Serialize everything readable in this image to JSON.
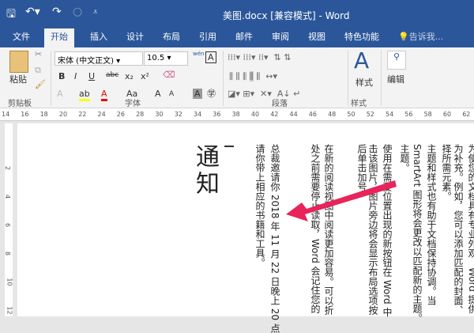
{
  "titlebar": {
    "title": "美图.docx [兼容模式] - Word"
  },
  "tabs": [
    "文件",
    "开始",
    "插入",
    "设计",
    "布局",
    "引用",
    "邮件",
    "审阅",
    "视图",
    "特色功能"
  ],
  "tell_me": "告诉我...",
  "ribbon": {
    "paste": "粘贴",
    "font_name": "宋体 (中文正文)",
    "font_size": "10.5",
    "bold": "B",
    "italic": "I",
    "underline": "U",
    "strike": "abc",
    "sub": "x₂",
    "sup": "x²",
    "change_case": "Aa",
    "grow": "A",
    "shrink": "A",
    "char_shade": "A",
    "phonetic": "wén",
    "styles": "样式",
    "editing": "编辑",
    "groups": [
      "剪贴板",
      "字体",
      "段落",
      "样式"
    ]
  },
  "ruler": [
    "14",
    "16",
    "18",
    "20",
    "22",
    "24",
    "26",
    "28",
    "30",
    "32",
    "34",
    "36",
    "38",
    "40",
    "42",
    "44",
    "46",
    "48",
    "50",
    "52",
    "54",
    "56",
    "58",
    "60",
    "62"
  ],
  "vruler": [
    "2",
    "4",
    "6",
    "8",
    "10",
    "12"
  ],
  "document": {
    "heading": "通知",
    "columns": [
      "为使您的文档具有专业外观，Word 提供",
      "为补充。例如，您可以添加匹配的封面、",
      "择所需元素。",
      "主题和样式也有助于文档保持协调。当",
      "SmartArt 图形将会更改以匹配新的主题。",
      "主题。",
      "使用在需要位置出现的新按钮在 Word 中",
      "击该图片，图片旁边将会显示布局选项按",
      "后单击加号。",
      "在新的阅读视图中阅读更加容易。可以折",
      "处之前需要停止读取，Word 会记住您的",
      "总裁邀请你 2018 年 11 月 22 日晚上 20 点",
      "请你带上相应的书籍和工具。"
    ]
  },
  "colors": {
    "brand": "#2b579a",
    "arrow": "#e8245a"
  }
}
